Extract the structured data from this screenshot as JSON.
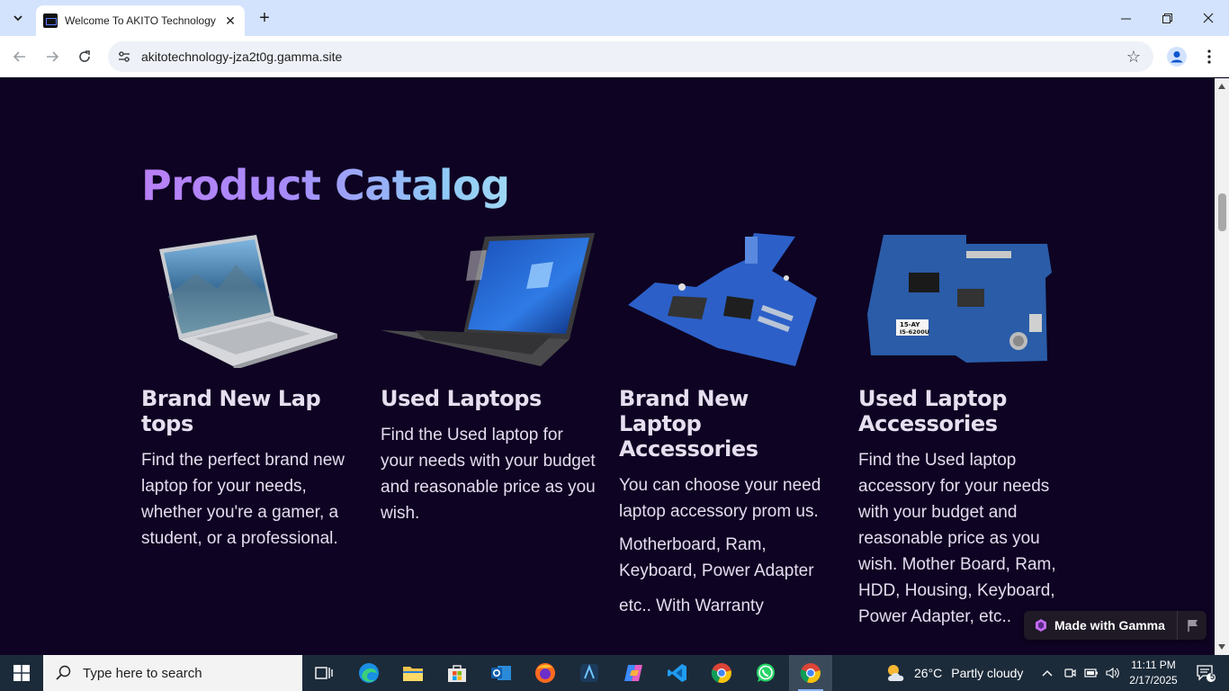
{
  "browser": {
    "tab_title": "Welcome To AKITO Technology",
    "url": "akitotechnology-jza2t0g.gamma.site",
    "new_tab_symbol": "+",
    "close_symbol": "✕"
  },
  "page": {
    "title": "Product Catalog",
    "cards": [
      {
        "title": "Brand New Lap tops",
        "text": "Find the perfect brand new laptop for your needs, whether you're a gamer, a student, or a professional.",
        "image_icon": "silver-laptop-image"
      },
      {
        "title": "Used Laptops",
        "text": "Find the Used laptop for your needs with your budget and reasonable price as you wish.",
        "image_icon": "dark-laptop-image"
      },
      {
        "title": "Brand New Laptop Accessories",
        "text": "You can choose your need laptop accessory prom us.",
        "text2": "Motherboard,  Ram, Keyboard, Power Adapter",
        "text3": "etc.. With Warranty",
        "image_icon": "motherboard-image"
      },
      {
        "title": "Used Laptop Accessories",
        "text": "Find the Used laptop accessory for your needs with your budget and reasonable price as you wish. Mother Board, Ram, HDD, Housing, Keyboard, Power Adapter, etc..",
        "image_icon": "motherboard-image-2",
        "board_label_1": "15-AY",
        "board_label_2": "I5-6200U"
      }
    ],
    "badge": "Made with Gamma"
  },
  "taskbar": {
    "search_placeholder": "Type here to search",
    "weather_temp": "26°C",
    "weather_desc": "Partly cloudy",
    "time": "11:11 PM",
    "date": "2/17/2025",
    "notification_count": "5"
  },
  "colors": {
    "page_bg": "#0e0322",
    "title_gradient_start": "#b980f5",
    "title_gradient_end": "#9fd8f5",
    "taskbar_bg": "#1c2b3a",
    "tabbar_bg": "#d3e3fd"
  }
}
